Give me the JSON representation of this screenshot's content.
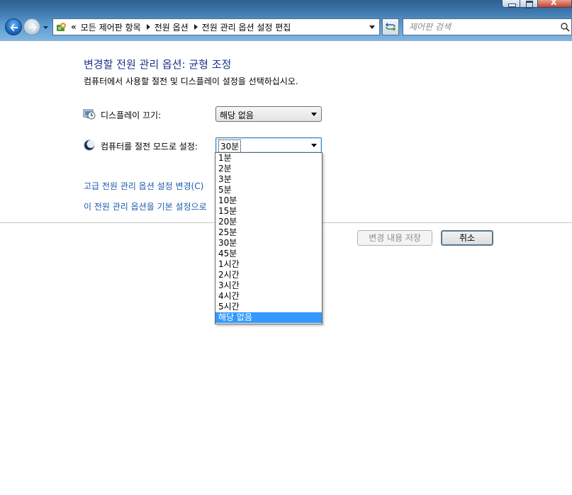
{
  "address": {
    "overflow_symbol": "«",
    "crumbs": [
      "모든 제어판 항목",
      "전원 옵션",
      "전원 관리 옵션 설정 편집"
    ]
  },
  "search": {
    "placeholder": "제어판 검색"
  },
  "main": {
    "title": "변경할 전원 관리 옵션: 균형 조정",
    "description": "컴퓨터에서 사용할 절전 및 디스플레이 설정을 선택하십시오.",
    "display_off": {
      "label": "디스플레이 끄기:",
      "value": "해당 없음"
    },
    "sleep": {
      "label": "컴퓨터를 절전 모드로 설정:",
      "value": "30분"
    },
    "links": {
      "advanced": "고급 전원 관리 옵션 설정 변경(C)",
      "restore": "이 전원 관리 옵션을 기본 설정으로"
    },
    "buttons": {
      "save": "변경 내용 저장",
      "cancel": "취소"
    }
  },
  "dropdown": {
    "options": [
      "1분",
      "2분",
      "3분",
      "5분",
      "10분",
      "15분",
      "20분",
      "25분",
      "30분",
      "45분",
      "1시간",
      "2시간",
      "3시간",
      "4시간",
      "5시간",
      "해당 없음"
    ],
    "highlighted_index": 15
  },
  "colors": {
    "title": "#1e3287",
    "link": "#1c5bb0",
    "highlight": "#3399ff"
  }
}
